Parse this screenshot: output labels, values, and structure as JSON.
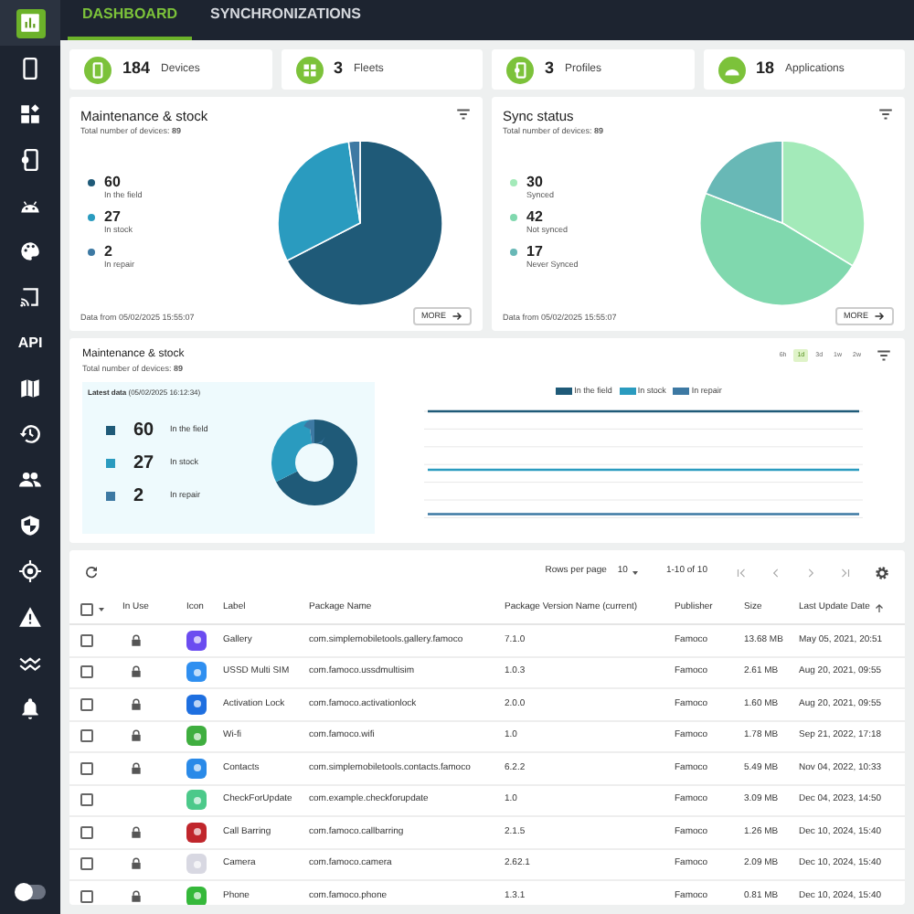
{
  "sidebar": {
    "items": [
      {
        "selected": true
      },
      {
        "selected": false
      },
      {
        "selected": false
      },
      {
        "selected": false
      },
      {
        "selected": false
      },
      {
        "selected": false
      },
      {
        "selected": false
      },
      {
        "label": "API",
        "selected": false
      },
      {
        "selected": false
      },
      {
        "selected": false
      },
      {
        "selected": false
      },
      {
        "selected": false
      },
      {
        "selected": false
      },
      {
        "selected": false
      },
      {
        "selected": false
      },
      {
        "selected": false
      }
    ],
    "theme_toggle": {
      "on": false
    }
  },
  "tabs": [
    {
      "label": "DASHBOARD",
      "selected": true
    },
    {
      "label": "SYNCHRONIZATIONS",
      "selected": false
    }
  ],
  "stats": [
    {
      "value": "184",
      "label": "Devices"
    },
    {
      "value": "3",
      "label": "Fleets"
    },
    {
      "value": "3",
      "label": "Profiles"
    },
    {
      "value": "18",
      "label": "Applications"
    }
  ],
  "pie_cards": [
    {
      "title": "Maintenance & stock",
      "subtitle": "Total number of devices: **89**",
      "legend": [
        {
          "value": "60",
          "label": "In the field",
          "color": "#1f5a78"
        },
        {
          "value": "27",
          "label": "In stock",
          "color": "#2a9bbf"
        },
        {
          "value": "2",
          "label": "In repair",
          "color": "#3d79a3"
        }
      ],
      "footer": "Data from 05/02/2025 15:55:07",
      "more": "MORE"
    },
    {
      "title": "Sync status",
      "subtitle": "Total number of devices: **89**",
      "legend": [
        {
          "value": "30",
          "label": "Synced",
          "color": "#a3eab9"
        },
        {
          "value": "42",
          "label": "Not synced",
          "color": "#80d8ae"
        },
        {
          "value": "17",
          "label": "Never Synced",
          "color": "#68b8b6"
        }
      ],
      "footer": "Data from 05/02/2025 15:55:07",
      "more": "MORE"
    }
  ],
  "timeline_card": {
    "title": "Maintenance & stock",
    "subtitle": "Total number of devices: **89**",
    "latest": "**Latest data** (05/02/2025 16:12:34)",
    "legend": [
      {
        "value": "60",
        "label": "In the field",
        "color": "#1f5a78"
      },
      {
        "value": "27",
        "label": "In stock",
        "color": "#2a9bbf"
      },
      {
        "value": "2",
        "label": "In repair",
        "color": "#3d79a3"
      }
    ],
    "ranges": [
      {
        "label": "6h",
        "selected": false
      },
      {
        "label": "1d",
        "selected": true
      },
      {
        "label": "3d",
        "selected": false
      },
      {
        "label": "1w",
        "selected": false
      },
      {
        "label": "2w",
        "selected": false
      }
    ],
    "chart_legend": [
      "In the field",
      "In stock",
      "In repair"
    ]
  },
  "table": {
    "select_all_checked": false,
    "rows_per_page_label": "Rows per page",
    "rows_per_page": "10",
    "range": "1-10 of 10",
    "columns": [
      "In Use",
      "Icon",
      "Label",
      "Package Name",
      "Package Version Name (current)",
      "Publisher",
      "Size",
      "Last Update Date"
    ],
    "rows": [
      {
        "checked": false,
        "in_use": true,
        "label": "Gallery",
        "package": "com.simplemobiletools.gallery.famoco",
        "version": "7.1.0",
        "publisher": "Famoco",
        "size": "13.68 MB",
        "date": "May 05, 2021, 20:51"
      },
      {
        "checked": false,
        "in_use": true,
        "label": "USSD Multi SIM",
        "package": "com.famoco.ussdmultisim",
        "version": "1.0.3",
        "publisher": "Famoco",
        "size": "2.61 MB",
        "date": "Aug 20, 2021, 09:55"
      },
      {
        "checked": false,
        "in_use": true,
        "label": "Activation Lock",
        "package": "com.famoco.activationlock",
        "version": "2.0.0",
        "publisher": "Famoco",
        "size": "1.60 MB",
        "date": "Aug 20, 2021, 09:55"
      },
      {
        "checked": false,
        "in_use": true,
        "label": "Wi-fi",
        "package": "com.famoco.wifi",
        "version": "1.0",
        "publisher": "Famoco",
        "size": "1.78 MB",
        "date": "Sep 21, 2022, 17:18"
      },
      {
        "checked": false,
        "in_use": true,
        "label": "Contacts",
        "package": "com.simplemobiletools.contacts.famoco",
        "version": "6.2.2",
        "publisher": "Famoco",
        "size": "5.49 MB",
        "date": "Nov 04, 2022, 10:33"
      },
      {
        "checked": false,
        "in_use": false,
        "label": "CheckForUpdate",
        "package": "com.example.checkforupdate",
        "version": "1.0",
        "publisher": "Famoco",
        "size": "3.09 MB",
        "date": "Dec 04, 2023, 14:50"
      },
      {
        "checked": false,
        "in_use": true,
        "label": "Call Barring",
        "package": "com.famoco.callbarring",
        "version": "2.1.5",
        "publisher": "Famoco",
        "size": "1.26 MB",
        "date": "Dec 10, 2024, 15:40"
      },
      {
        "checked": false,
        "in_use": true,
        "label": "Camera",
        "package": "com.famoco.camera",
        "version": "2.62.1",
        "publisher": "Famoco",
        "size": "2.09 MB",
        "date": "Dec 10, 2024, 15:40"
      },
      {
        "checked": false,
        "in_use": true,
        "label": "Phone",
        "package": "com.famoco.phone",
        "version": "1.3.1",
        "publisher": "Famoco",
        "size": "0.81 MB",
        "date": "Dec 10, 2024, 15:40"
      }
    ]
  }
}
